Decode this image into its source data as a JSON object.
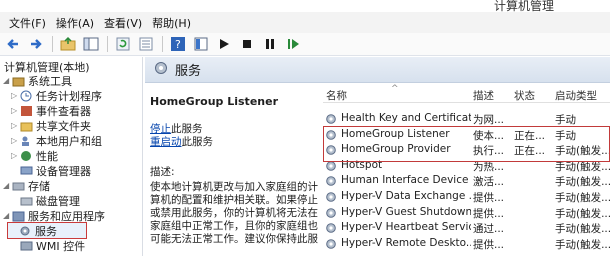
{
  "window": {
    "title": "计算机管理"
  },
  "menu": [
    "文件(F)",
    "操作(A)",
    "查看(V)",
    "帮助(H)"
  ],
  "toolbar": {
    "icons": [
      "back-arrow-icon",
      "forward-arrow-icon",
      "up-folder-icon",
      "console-tree-icon",
      "refresh-icon",
      "export-list-icon",
      "help-icon",
      "properties-icon",
      "play-icon",
      "stop-icon",
      "pause-icon",
      "resume-icon"
    ]
  },
  "tree": {
    "root": "计算机管理(本地)",
    "system_tools": "系统工具",
    "task_scheduler": "任务计划程序",
    "event_viewer": "事件查看器",
    "shared_folders": "共享文件夹",
    "local_users": "本地用户和组",
    "performance": "性能",
    "device_manager": "设备管理器",
    "storage": "存储",
    "disk_management": "磁盘管理",
    "services_apps": "服务和应用程序",
    "services": "服务",
    "wmi": "WMI 控件"
  },
  "content": {
    "header_title": "服务",
    "selected_service": "HomeGroup Listener",
    "stop_link": "停止",
    "stop_suffix": "此服务",
    "restart_link": "重启动",
    "restart_suffix": "此服务",
    "desc_label": "描述:",
    "desc_text": "使本地计算机更改与加入家庭组的计算机的配置和维护相关联。如果停止或禁用此服务，你的计算机将无法在家庭组中正常工作，且你的家庭组也可能无法正常工作。建议你保持此服"
  },
  "list": {
    "columns": [
      "名称",
      "描述",
      "状态",
      "启动类型"
    ],
    "rows": [
      [
        "Health Key and Certificat...",
        "为网...",
        "",
        "手动"
      ],
      [
        "HomeGroup Listener",
        "使本...",
        "正在...",
        "手动"
      ],
      [
        "HomeGroup Provider",
        "执行...",
        "正在...",
        "手动(触发..."
      ],
      [
        "Hotspot",
        "为热...",
        "",
        "手动(触发..."
      ],
      [
        "Human Interface Device ...",
        "激活...",
        "",
        "手动(触发..."
      ],
      [
        "Hyper-V Data Exchange ...",
        "提供...",
        "",
        "手动(触发..."
      ],
      [
        "Hyper-V Guest Shutdown...",
        "提供...",
        "",
        "手动(触发..."
      ],
      [
        "Hyper-V Heartbeat Service",
        "通过...",
        "",
        "手动(触发..."
      ],
      [
        "Hyper-V Remote Deskto...",
        "提供...",
        "",
        "手动(触发..."
      ]
    ]
  }
}
